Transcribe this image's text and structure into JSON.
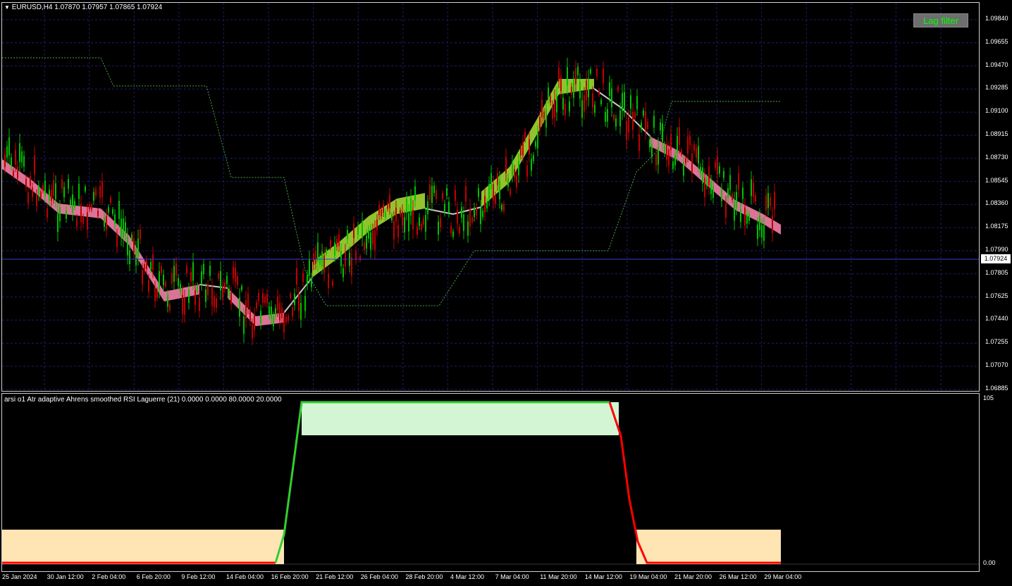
{
  "symbol_info": "EURUSD,H4  1.07870 1.07957 1.07865 1.07924",
  "lag_filter_button": "Lag filter",
  "current_price": "1.07924",
  "price_axis": [
    "1.09840",
    "1.09655",
    "1.09470",
    "1.09285",
    "1.09100",
    "1.08915",
    "1.08730",
    "1.08545",
    "1.08360",
    "1.08175",
    "1.07990",
    "1.07805",
    "1.07625",
    "1.07440",
    "1.07255",
    "1.07070",
    "1.06885"
  ],
  "indicator_title": "arsi o1 Atr adaptive Ahrens smoothed RSI Laguerre (21) 0.0000 0.0000 80.0000 20.0000",
  "indicator_axis": {
    "top": "105",
    "bottom": "0.00"
  },
  "time_axis": [
    "25 Jan 2024",
    "30 Jan 12:00",
    "2 Feb 04:00",
    "6 Feb 20:00",
    "9 Feb 12:00",
    "14 Feb 04:00",
    "16 Feb 20:00",
    "21 Feb 12:00",
    "26 Feb 04:00",
    "28 Feb 20:00",
    "4 Mar 12:00",
    "7 Mar 04:00",
    "11 Mar 20:00",
    "14 Mar 12:00",
    "19 Mar 04:00",
    "21 Mar 20:00",
    "26 Mar 12:00",
    "29 Mar 04:00"
  ],
  "colors": {
    "bull_candle": "#00c000",
    "bear_candle": "#c00000",
    "band_up": "#9acd32",
    "band_down": "#e8799e",
    "line_neutral": "#c8c8c8",
    "grid": "#1c1c6e",
    "osc_up": "#32cd32",
    "osc_down": "#ff0000"
  }
}
